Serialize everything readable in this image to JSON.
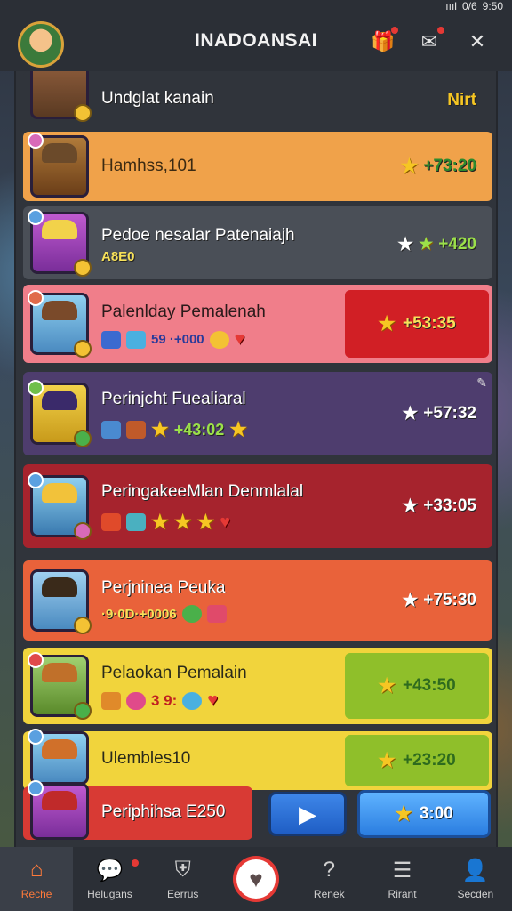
{
  "status_bar": {
    "signal": "ıııl",
    "battery": "0/6",
    "time": "9:50"
  },
  "header": {
    "title": "INADOANSAI",
    "icons": [
      "gift-icon",
      "mail-icon",
      "close-icon"
    ]
  },
  "rows": [
    {
      "name": "Undglat kanain",
      "score": "Nirt"
    },
    {
      "name": "Hamhss,101",
      "score": "+73:20"
    },
    {
      "name": "Pedoe nesalar Patenaiajh",
      "sub": "A8E0",
      "score": "+420"
    },
    {
      "name": "Palenlday Pemalenah",
      "inv_text": "59 ·+000",
      "score": "+53:35"
    },
    {
      "name": "Perinjcht Fuealiaral",
      "inv_text": "+43:02",
      "score": "+57:32"
    },
    {
      "name": "PeringakeeMlan Denmlalal",
      "score": "+33:05"
    },
    {
      "name": "Perjninea Peuka",
      "inv_text": "·9·0D·+0006",
      "score": "+75:30"
    },
    {
      "name": "Pelaokan Pemalain",
      "inv_text": "3 9:",
      "score": "+43:50"
    },
    {
      "name": "Ulembles10",
      "score": "+23:20"
    },
    {
      "name": "Periphihsa E250"
    }
  ],
  "buttons": {
    "claim_label": "3:00"
  },
  "tabbar": {
    "tabs": [
      {
        "label": "Reche",
        "icon": "home-icon"
      },
      {
        "label": "Helugans",
        "icon": "chat-icon"
      },
      {
        "label": "Eerrus",
        "icon": "shield-icon"
      },
      {
        "label": "",
        "icon": "heart-icon"
      },
      {
        "label": "Renek",
        "icon": "help-icon"
      },
      {
        "label": "Rirant",
        "icon": "list-icon"
      },
      {
        "label": "Secden",
        "icon": "profile-icon"
      }
    ]
  },
  "colors": {
    "orange_row": "#f0a24a",
    "gray_row": "#4a4f57",
    "pink_row": "#f07e8a",
    "purple_row": "#4e3d6e",
    "red_row": "#a6232d",
    "orange_red_row": "#e9623a",
    "yellow_row": "#f1d43c",
    "green_box": "#8fbf2a",
    "red_box": "#d11f25",
    "tab_active": "#ff7a3a"
  }
}
